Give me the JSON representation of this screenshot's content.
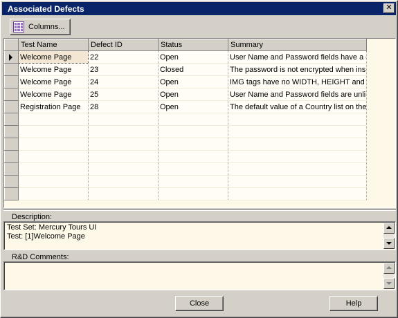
{
  "window": {
    "title": "Associated Defects",
    "close_glyph": "✕"
  },
  "toolbar": {
    "columns_label": "Columns..."
  },
  "grid": {
    "columns": [
      "Test Name",
      "Defect ID",
      "Status",
      "Summary"
    ],
    "rows": [
      {
        "test_name": "Welcome Page",
        "defect_id": "22",
        "status": "Open",
        "summary": "User Name and Password fields have a d"
      },
      {
        "test_name": "Welcome Page",
        "defect_id": "23",
        "status": "Closed",
        "summary": "The password is not encrypted when ins"
      },
      {
        "test_name": "Welcome Page",
        "defect_id": "24",
        "status": "Open",
        "summary": "IMG tags have no WIDTH, HEIGHT and AL"
      },
      {
        "test_name": "Welcome Page",
        "defect_id": "25",
        "status": "Open",
        "summary": "User Name and Password fields are unlin"
      },
      {
        "test_name": "Registration Page",
        "defect_id": "28",
        "status": "Open",
        "summary": "The default value of a Country list on the"
      }
    ]
  },
  "description": {
    "label": "Description:",
    "line1": "Test Set: Mercury Tours UI",
    "line2": "Test: [1]Welcome Page"
  },
  "comments": {
    "label": "R&D Comments:"
  },
  "footer": {
    "close_label": "Close",
    "help_label": "Help"
  }
}
